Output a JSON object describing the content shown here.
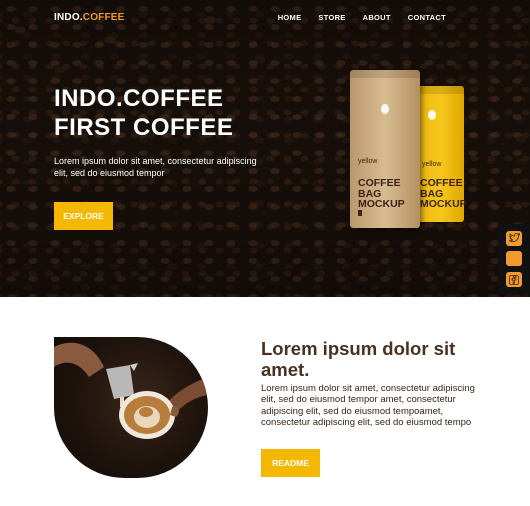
{
  "brand": {
    "name_main": "INDO.",
    "name_accent": "COFFEE",
    "accent_color": "#f29a2e"
  },
  "nav": {
    "items": [
      "HOME",
      "STORE",
      "ABOUT",
      "CONTACT"
    ]
  },
  "hero": {
    "title_line1": "INDO.COFFEE",
    "title_line2": "FIRST COFFEE",
    "subtitle": "Lorem ipsum dolor sit amet, consectetur adipiscing elit, sed do eiusmod tempor",
    "cta_label": "EXPLORE",
    "cta_color": "#f5b800"
  },
  "product_bags": [
    {
      "brand": "yellow",
      "line1": "COFFEE",
      "line2": "BAG",
      "line3": "MOCKUP"
    },
    {
      "brand": "yellow",
      "line1": "COFFEE",
      "line2": "BAG",
      "line3": "MOCKUP"
    }
  ],
  "social": {
    "icons": [
      "twitter-icon",
      "social-icon",
      "facebook-icon"
    ]
  },
  "about": {
    "title": "Lorem ipsum dolor sit amet.",
    "body": "Lorem ipsum dolor sit amet, consectetur adipiscing elit, sed do eiusmod tempor amet, consectetur adipiscing elit, sed do eiusmod tempoamet, consectetur adipiscing elit, sed do eiusmod tempo",
    "cta_label": "README",
    "title_color": "#4a3120"
  }
}
